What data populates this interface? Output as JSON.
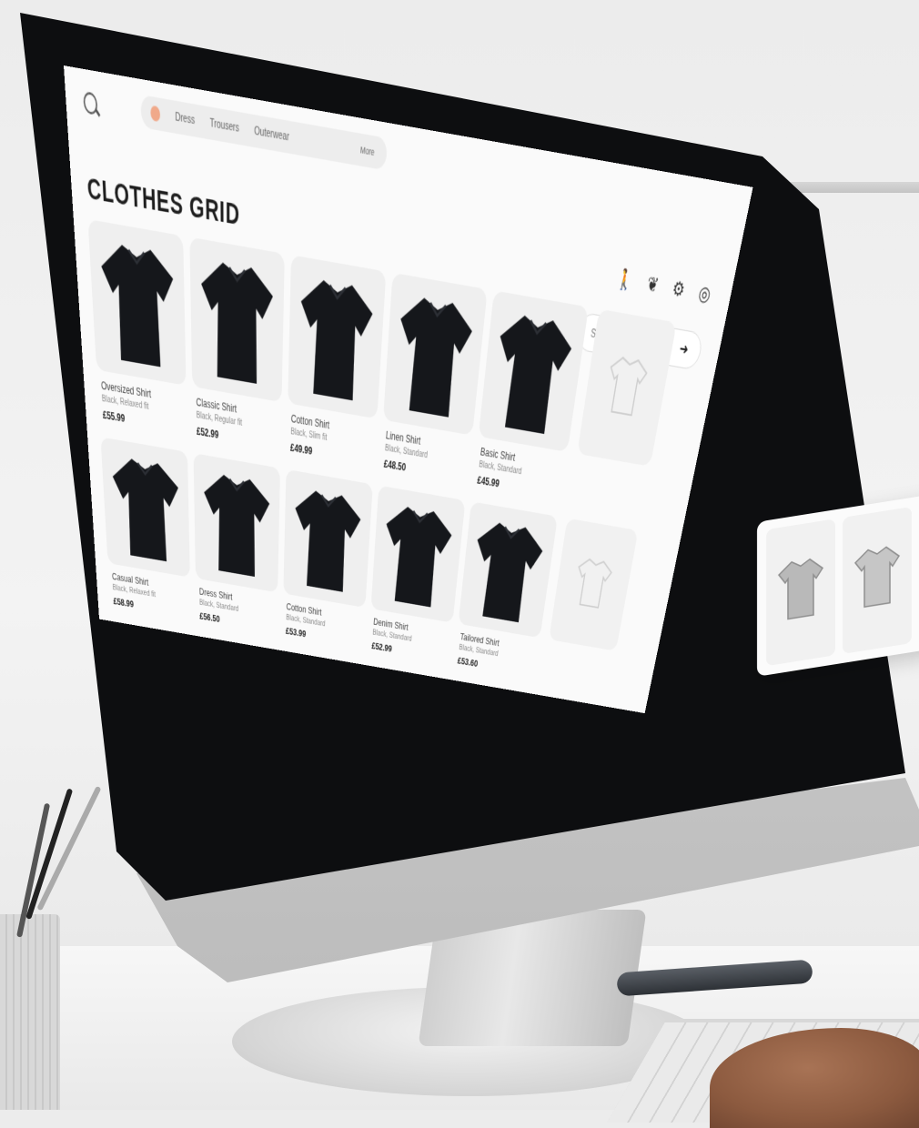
{
  "nav": {
    "items": [
      "Dress",
      "Trousers",
      "Outerwear"
    ],
    "more": "More"
  },
  "page_title": "CLOTHES GRID",
  "toolbar_icons": [
    "person-icon",
    "hanger-icon",
    "filter-icon",
    "settings-icon"
  ],
  "sort": {
    "label": "Sort by",
    "arrow": "➜"
  },
  "products": [
    {
      "name": "Oversized Shirt",
      "sub": "Black, Relaxed fit",
      "price": "£55.99"
    },
    {
      "name": "Classic Shirt",
      "sub": "Black, Regular fit",
      "price": "£52.99"
    },
    {
      "name": "Cotton Shirt",
      "sub": "Black, Slim fit",
      "price": "£49.99"
    },
    {
      "name": "Linen Shirt",
      "sub": "Black, Standard",
      "price": "£48.50"
    },
    {
      "name": "Basic Shirt",
      "sub": "Black, Standard",
      "price": "£45.99"
    },
    {
      "name": "Casual Shirt",
      "sub": "Black, Relaxed fit",
      "price": "£58.99"
    },
    {
      "name": "Dress Shirt",
      "sub": "Black, Standard",
      "price": "£56.50"
    },
    {
      "name": "Cotton Shirt",
      "sub": "Black, Standard",
      "price": "£53.99"
    },
    {
      "name": "Denim Shirt",
      "sub": "Black, Standard",
      "price": "£52.99"
    },
    {
      "name": "Tailored Shirt",
      "sub": "Black, Standard",
      "price": "£53.60"
    }
  ],
  "colors": {
    "shirt": "#15171b",
    "accent_dot": "#f0a98a",
    "card_bg": "#efefef"
  }
}
